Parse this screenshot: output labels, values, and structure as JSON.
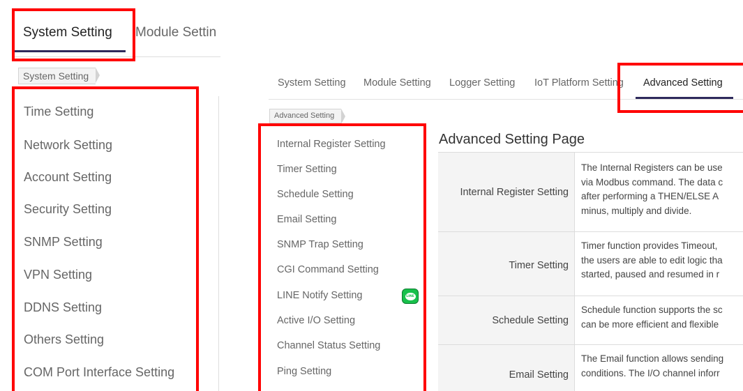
{
  "left_panel": {
    "tabs": [
      "System Setting",
      "Module Settin"
    ],
    "breadcrumb": "System Setting",
    "menu": [
      "Time Setting",
      "Network Setting",
      "Account Setting",
      "Security Setting",
      "SNMP Setting",
      "VPN Setting",
      "DDNS Setting",
      "Others Setting",
      "COM Port Interface Setting"
    ]
  },
  "right_panel": {
    "tabs": [
      "System Setting",
      "Module Setting",
      "Logger Setting",
      "IoT Platform Setting",
      "Advanced Setting"
    ],
    "breadcrumb": "Advanced Setting",
    "menu": [
      "Internal Register Setting",
      "Timer Setting",
      "Schedule Setting",
      "Email Setting",
      "SNMP Trap Setting",
      "CGI Command Setting",
      "LINE Notify Setting",
      "Active I/O Setting",
      "Channel Status Setting",
      "Ping Setting"
    ],
    "line_icon_text": "LINE",
    "page_title": "Advanced Setting Page",
    "table": [
      {
        "label": "Internal Register Setting",
        "lines": [
          "The Internal Registers can be use",
          "via Modbus command. The data c",
          "after performing a THEN/ELSE A",
          "minus, multiply and divide."
        ]
      },
      {
        "label": "Timer Setting",
        "lines": [
          "Timer function provides Timeout,",
          "the users are able to edit logic tha",
          "started, paused and resumed in r"
        ]
      },
      {
        "label": "Schedule Setting",
        "lines": [
          "Schedule function supports the sc",
          "can be more efficient and flexible"
        ]
      },
      {
        "label": "Email Setting",
        "lines": [
          "The Email function allows sending",
          "conditions. The I/O channel inforr"
        ]
      }
    ]
  },
  "highlight_color": "#ff0000",
  "accent_color": "#2e2a5c",
  "icons": {
    "line_app": "line-notify-icon"
  }
}
